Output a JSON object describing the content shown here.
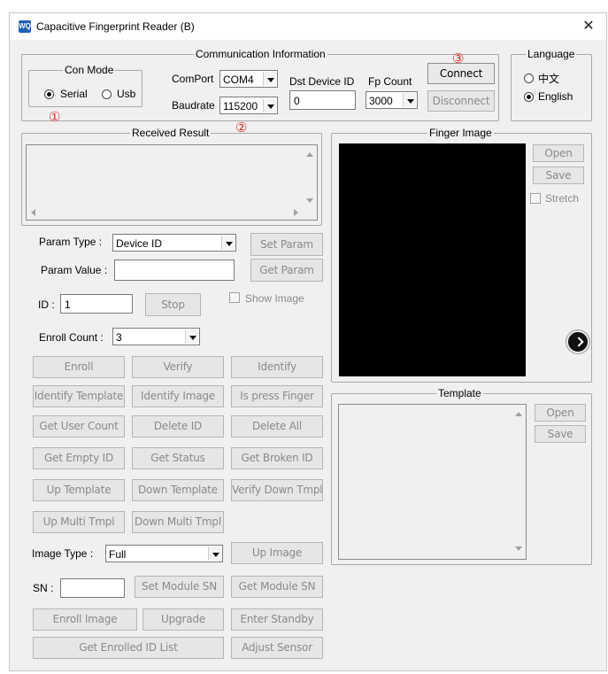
{
  "window": {
    "title": "Capacitive Fingerprint Reader (B)",
    "icon": "wq-app-icon",
    "close_glyph": "✕"
  },
  "comm": {
    "legend": "Communication Information",
    "con_mode": {
      "legend": "Con Mode",
      "options": [
        "Serial",
        "Usb"
      ],
      "selected": "Serial"
    },
    "comport_label": "ComPort",
    "comport_value": "COM4",
    "baudrate_label": "Baudrate",
    "baudrate_value": "115200",
    "dst_label": "Dst Device ID",
    "dst_value": "0",
    "fp_count_label": "Fp Count",
    "fp_count_value": "3000",
    "connect": "Connect",
    "disconnect": "Disconnect",
    "markers": [
      "①",
      "②",
      "③"
    ]
  },
  "language": {
    "legend": "Language",
    "options": [
      "中文",
      "English"
    ],
    "selected": "English"
  },
  "received": {
    "legend": "Received Result"
  },
  "finger_image": {
    "legend": "Finger Image",
    "open": "Open",
    "save": "Save",
    "stretch": "Stretch"
  },
  "template": {
    "legend": "Template",
    "open": "Open",
    "save": "Save"
  },
  "params": {
    "param_type_label": "Param Type :",
    "param_type_value": "Device ID",
    "set_param": "Set Param",
    "param_value_label": "Param Value :",
    "get_param": "Get Param",
    "id_label": "ID :",
    "id_value": "1",
    "stop": "Stop",
    "show_image": "Show Image",
    "enroll_count_label": "Enroll Count :",
    "enroll_count_value": "3"
  },
  "actions": {
    "row1": [
      "Enroll",
      "Verify",
      "Identify"
    ],
    "row2": [
      "Identify Template",
      "Identify Image",
      "Is press Finger"
    ],
    "row3": [
      "Get User Count",
      "Delete ID",
      "Delete All"
    ],
    "row4": [
      "Get Empty ID",
      "Get Status",
      "Get Broken ID"
    ],
    "row5": [
      "Up Template",
      "Down Template",
      "Verify Down Tmpl"
    ],
    "row6": [
      "Up Multi Tmpl",
      "Down Multi Tmpl"
    ]
  },
  "image": {
    "type_label": "Image Type :",
    "type_value": "Full",
    "up_image": "Up Image"
  },
  "sn": {
    "label": "SN :",
    "value": "",
    "set": "Set Module SN",
    "get": "Get Module SN"
  },
  "bottom": {
    "enroll_image": "Enroll Image",
    "upgrade": "Upgrade",
    "enter_standby": "Enter Standby",
    "get_enrolled": "Get Enrolled ID List",
    "adjust_sensor": "Adjust Sensor"
  }
}
